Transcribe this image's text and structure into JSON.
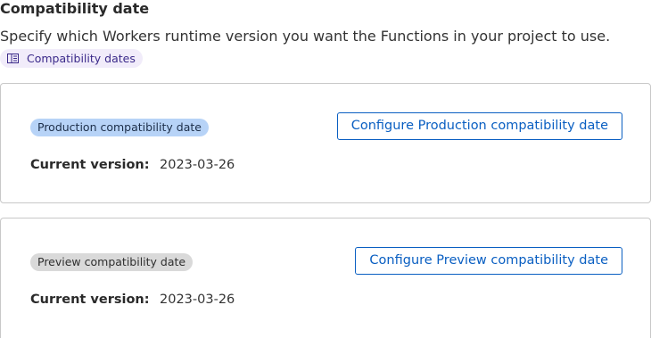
{
  "section": {
    "title": "Compatibility date",
    "description": "Specify which Workers runtime version you want the Functions in your project to use.",
    "docs_link": {
      "label": "Compatibility dates",
      "icon": "book-icon",
      "bg_color": "#f1ecfa"
    }
  },
  "cards": {
    "production": {
      "badge": "Production compatibility date",
      "badge_color": "#b7d3f7",
      "button": "Configure Production compatibility date",
      "version_label": "Current version:",
      "version_value": "2023-03-26"
    },
    "preview": {
      "badge": "Preview compatibility date",
      "badge_color": "#d9d9d9",
      "button": "Configure Preview compatibility date",
      "version_label": "Current version:",
      "version_value": "2023-03-26"
    }
  },
  "colors": {
    "accent": "#0a5fc2"
  }
}
